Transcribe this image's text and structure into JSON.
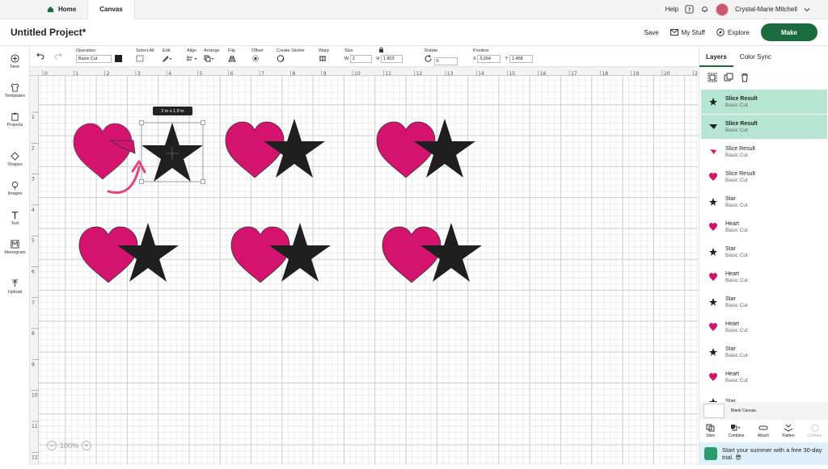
{
  "tabs": {
    "home": "Home",
    "canvas": "Canvas"
  },
  "header_right": {
    "help": "Help",
    "user": "Crystal-Marie Mitchell"
  },
  "project": {
    "title": "Untitled Project*"
  },
  "actions": {
    "save": "Save",
    "my_stuff": "My Stuff",
    "explore": "Explore",
    "make": "Make"
  },
  "leftbar": {
    "new": "New",
    "templates": "Templates",
    "projects": "Projects",
    "shapes": "Shapes",
    "images": "Images",
    "text": "Text",
    "monogram": "Monogram",
    "upload": "Upload"
  },
  "toolbar": {
    "operation_label": "Operation",
    "operation_value": "Basic Cut",
    "select_all": "Select All",
    "edit": "Edit",
    "align": "Align",
    "arrange": "Arrange",
    "flip": "Flip",
    "offset": "Offset",
    "create_sticker": "Create Sticker",
    "warp": "Warp",
    "size_label": "Size",
    "w_label": "W",
    "w_value": "2",
    "h_label": "H",
    "h_value": "1.903",
    "rotate_label": "Rotate",
    "rotate_value": "0",
    "position_label": "Position",
    "x_label": "X",
    "x_value": "3.264",
    "y_label": "Y",
    "y_value": "1.458"
  },
  "rulers": {
    "h": [
      "0",
      "1",
      "2",
      "3",
      "4",
      "5",
      "6",
      "7",
      "8",
      "9",
      "10",
      "11",
      "12",
      "13",
      "14",
      "15",
      "16",
      "17",
      "18",
      "19",
      "20",
      "21"
    ],
    "v": [
      "1",
      "2",
      "3",
      "4",
      "5",
      "6",
      "7",
      "8",
      "9",
      "10",
      "11",
      "12"
    ]
  },
  "canvas": {
    "size_tooltip": "2 in x 1.9 in",
    "zoom": "100%",
    "pink": "#d4136f",
    "black": "#1f1f1f"
  },
  "right_panel": {
    "tabs": [
      "Layers",
      "Color Sync"
    ],
    "layers": [
      {
        "name": "Slice Result",
        "op": "Basic Cut",
        "icon": "slice-star-icon",
        "selected": true
      },
      {
        "name": "Slice Result",
        "op": "Basic Cut",
        "icon": "slice-triangle-icon",
        "selected": true
      },
      {
        "name": "Slice Result",
        "op": "Basic Cut",
        "icon": "slice-pink-sliver-icon",
        "selected": false
      },
      {
        "name": "Slice Result",
        "op": "Basic Cut",
        "icon": "slice-heart-icon",
        "selected": false
      },
      {
        "name": "Star",
        "op": "Basic Cut",
        "icon": "star-icon",
        "selected": false
      },
      {
        "name": "Heart",
        "op": "Basic Cut",
        "icon": "heart-icon",
        "selected": false
      },
      {
        "name": "Star",
        "op": "Basic Cut",
        "icon": "star-icon",
        "selected": false
      },
      {
        "name": "Heart",
        "op": "Basic Cut",
        "icon": "heart-icon",
        "selected": false
      },
      {
        "name": "Star",
        "op": "Basic Cut",
        "icon": "star-icon",
        "selected": false
      },
      {
        "name": "Heart",
        "op": "Basic Cut",
        "icon": "heart-icon",
        "selected": false
      },
      {
        "name": "Star",
        "op": "Basic Cut",
        "icon": "star-icon",
        "selected": false
      },
      {
        "name": "Heart",
        "op": "Basic Cut",
        "icon": "heart-icon",
        "selected": false
      },
      {
        "name": "Star",
        "op": "",
        "icon": "star-icon",
        "selected": false
      }
    ],
    "blank_canvas": "Blank Canvas",
    "footer": {
      "slice": "Slice",
      "combine": "Combine",
      "attach": "Attach",
      "flatten": "Flatten",
      "contour": "Contour"
    },
    "promo": "Start your summer with a free 30-day trial. 😎"
  }
}
